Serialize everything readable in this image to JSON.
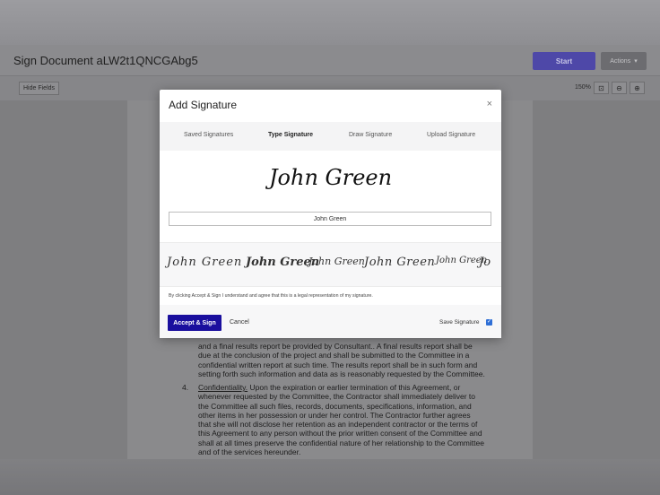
{
  "header": {
    "title": "Sign Document aLW2t1QNCGAbg5",
    "start_label": "Start",
    "actions_label": "Actions"
  },
  "toolbar": {
    "hide_fields_label": "Hide Fields",
    "zoom": "150%"
  },
  "document": {
    "lines_top": [
      "and a final results report be provided by Consultant..  A final results report shall be",
      "due at the conclusion of the project and shall be submitted to the Committee in a",
      "confidential written report at such time.  The results report shall be in such form and",
      "setting forth such information and data as is reasonably requested by the Committee."
    ],
    "item_number": "4.",
    "confidentiality_heading": "Confidentiality.",
    "confidentiality_first": "  Upon the expiration or earlier termination of this Agreement, or",
    "confidentiality_lines": [
      "whenever requested by the Committee, the Contractor shall immediately deliver to",
      "the Committee all such files, records, documents, specifications, information, and",
      "other items in her possession or under her control.  The Contractor further agrees",
      "that she will not disclose her retention as an independent contractor or the terms of",
      "this Agreement to any person without the prior written consent of the Committee and",
      "shall at all times preserve the confidential nature of her relationship to the Committee",
      "and of the services hereunder."
    ]
  },
  "modal": {
    "title": "Add Signature",
    "tabs": [
      {
        "label": "Saved Signatures",
        "active": false
      },
      {
        "label": "Type Signature",
        "active": true
      },
      {
        "label": "Draw Signature",
        "active": false
      },
      {
        "label": "Upload Signature",
        "active": false
      }
    ],
    "preview_text": "John Green",
    "input_value": "John Green",
    "style_options": [
      "John Green",
      "John Green",
      "John Green",
      "John Green",
      "John Green",
      "Jo"
    ],
    "legal_text": "By clicking Accept & Sign I understand and agree that this is a legal representation of my signature.",
    "accept_label": "Accept & Sign",
    "cancel_label": "Cancel",
    "save_signature_label": "Save Signature",
    "save_signature_checked": true
  },
  "colors": {
    "accept": "#1a0f9e",
    "start": "#4e48a8",
    "checkbox": "#2f6fd6"
  }
}
